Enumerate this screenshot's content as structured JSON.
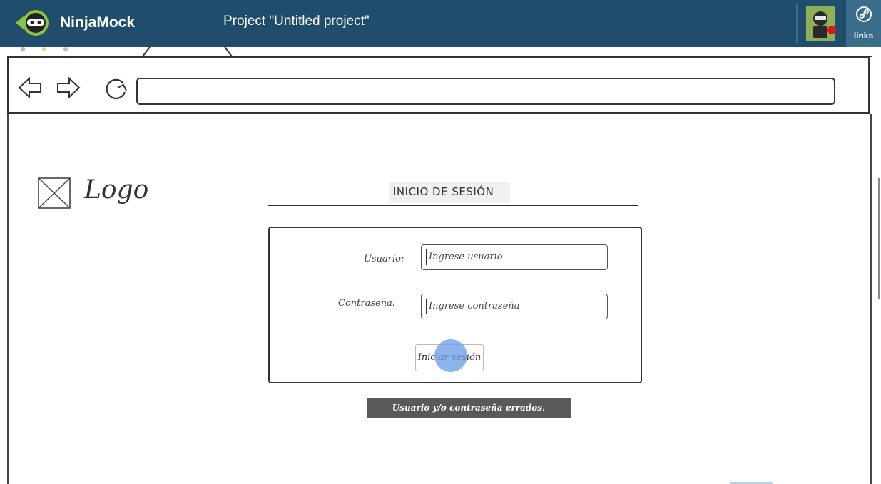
{
  "app": {
    "name": "NinjaMock",
    "project_title": "Project \"Untitled project\"",
    "links_label": "links",
    "colors": {
      "topbar": "#1f4d6b",
      "links_button": "#3a6c8c",
      "notification_dot": "#e0141e"
    }
  },
  "mockup": {
    "logo_text": "Logo",
    "login_title": "INICIO DE SESIÓN",
    "username_label": "Usuario:",
    "username_placeholder": "Ingrese usuario",
    "password_label": "Contraseña:",
    "password_placeholder": "Ingrese contraseña",
    "login_button": "Iniciar sesión",
    "error_message": "Usuario y/o contraseña errados."
  },
  "icons": {
    "app_logo": "ninja-logo-icon",
    "avatar": "ninja-avatar-icon",
    "links": "link-icon",
    "back": "arrow-left-icon",
    "forward": "arrow-right-icon",
    "refresh": "refresh-icon",
    "logo_placeholder": "image-placeholder-icon"
  }
}
